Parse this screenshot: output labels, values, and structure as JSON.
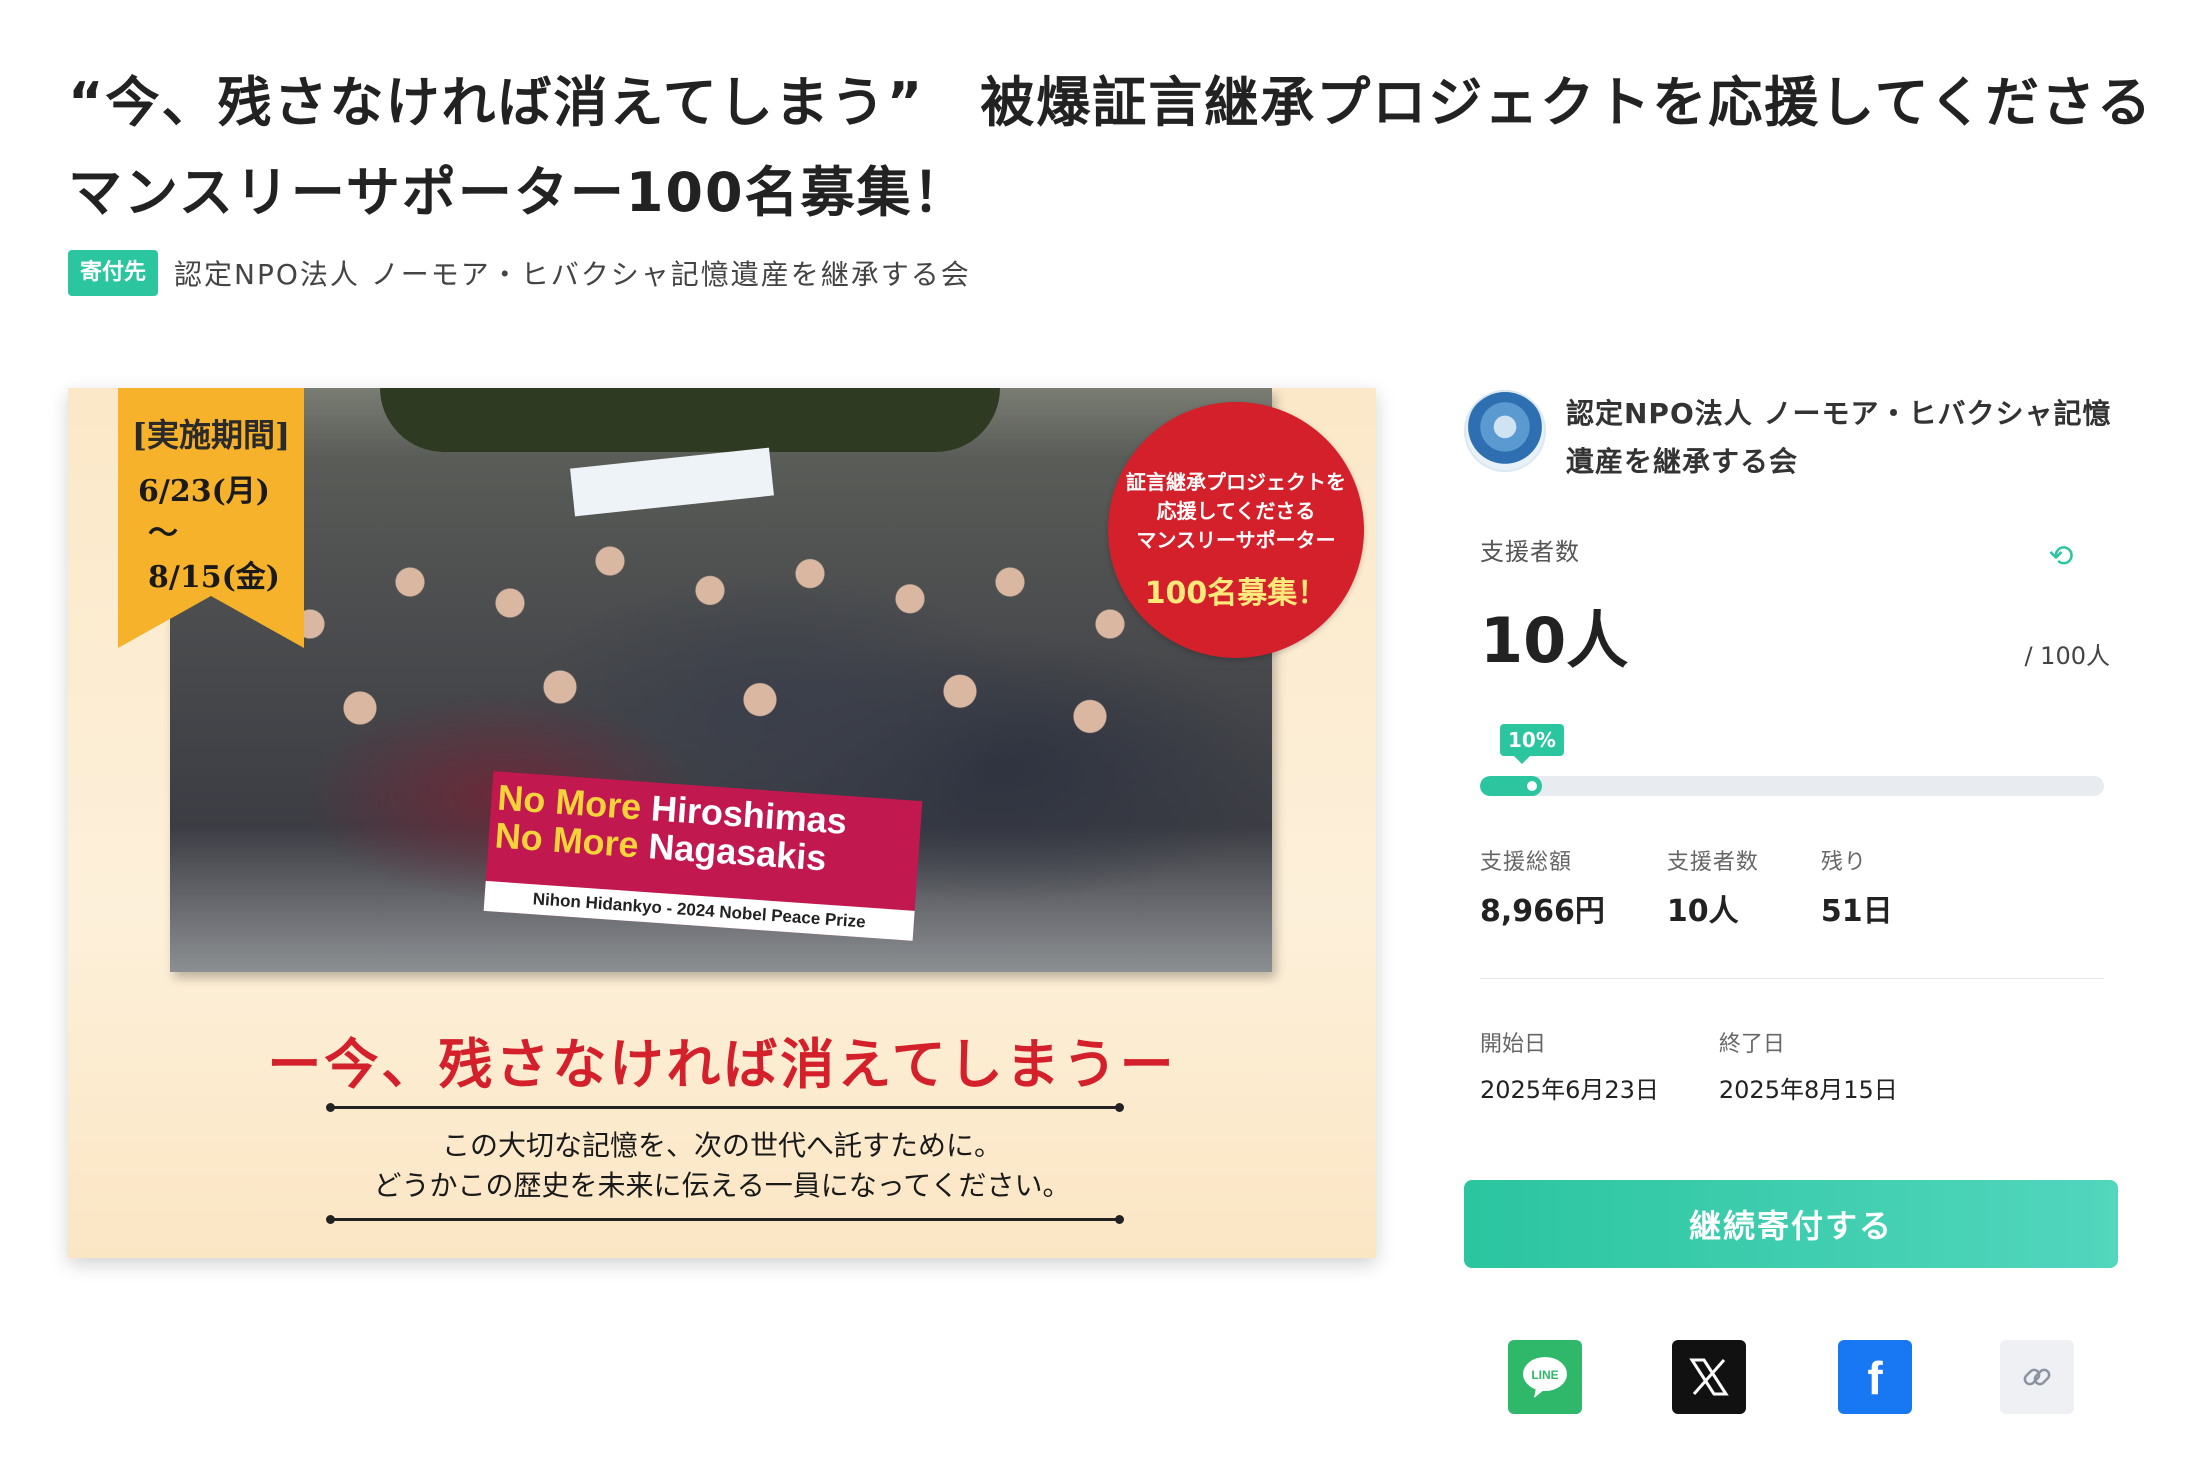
{
  "title": {
    "line1": "“今、残さなければ消えてしまう”　被爆証言継承プロジェクトを応援してくださる",
    "line2": "マンスリーサポーター100名募集！"
  },
  "recipient": {
    "badge": "寄付先",
    "name": "認定NPO法人 ノーモア・ヒバクシャ記憶遺産を継承する会"
  },
  "hero": {
    "ribbon": {
      "heading": "[実施期間]",
      "start": "6/23(月)",
      "end": "～8/15(金)"
    },
    "circle": {
      "text_l1": "証言継承プロジェクトを",
      "text_l2": "応援してくださる",
      "text_l3": "マンスリーサポーター",
      "highlight": "100名募集！"
    },
    "banner": {
      "no_more": "No More",
      "hiroshimas": "Hiroshimas",
      "nagasakis": "Nagasakis",
      "footer": "Nihon Hidankyo - 2024 Nobel Peace Prize"
    },
    "slogan": "ー今、残さなければ消えてしまうー",
    "sub1": "この大切な記憶を、次の世代へ託すために。",
    "sub2": "どうかこの歴史を未来に伝える一員になってください。"
  },
  "sidebar": {
    "org_name": "認定NPO法人 ノーモア・ヒバクシャ記憶遺産を継承する会",
    "supporters_label": "支援者数",
    "supporters_value": "10人",
    "goal": "/ 100人",
    "progress_label": "10%",
    "progress": 0.1,
    "stats": [
      {
        "label": "支援総額",
        "value": "8,966円"
      },
      {
        "label": "支援者数",
        "value": "10人"
      },
      {
        "label": "残り",
        "value": "51日"
      }
    ],
    "start_label": "開始日",
    "start_value": "2025年6月23日",
    "end_label": "終了日",
    "end_value": "2025年8月15日",
    "cta": "継続寄付する",
    "share": {
      "line": "LINE",
      "x": "X",
      "facebook": "f"
    }
  },
  "colors": {
    "accent": "#2bc5a0",
    "slogan": "#d4202a",
    "ribbon": "#f5b22a"
  },
  "icons": [
    "refresh-icon",
    "line-icon",
    "x-icon",
    "facebook-icon",
    "link-icon"
  ]
}
